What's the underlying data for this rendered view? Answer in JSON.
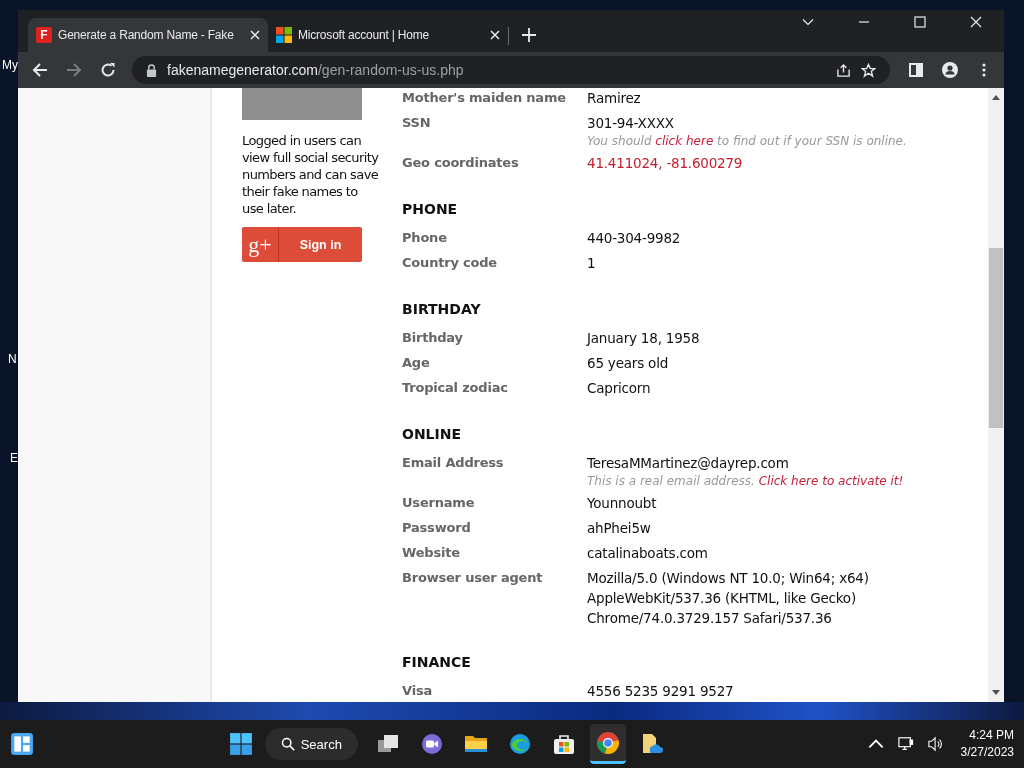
{
  "desktop_labels": [
    "My",
    "N",
    "E"
  ],
  "browser": {
    "tabs": [
      {
        "title": "Generate a Random Name - Fake",
        "selected": true,
        "kind": "letter",
        "favicon_text": "F"
      },
      {
        "title": "Microsoft account | Home",
        "selected": false,
        "kind": "squares"
      }
    ],
    "address": {
      "domain": "fakenamegenerator.com",
      "path": "/gen-random-us-us.php"
    },
    "back_disabled": false,
    "forward_disabled": true
  },
  "sidebar": {
    "note": "Logged in users can view full social security numbers and can save their fake names to use later.",
    "signin": {
      "logo": "g+",
      "label": "Sign in"
    }
  },
  "sections": [
    {
      "rows": [
        {
          "label": "Mother's maiden name",
          "value": [
            "Ramirez"
          ]
        },
        {
          "label": "SSN",
          "value": [
            "301-94-XXXX"
          ],
          "note": [
            {
              "text": "You should ",
              "link": false
            },
            {
              "text": "click here",
              "link": true
            },
            {
              "text": " to find out if your SSN is online.",
              "link": false
            }
          ]
        },
        {
          "label": "Geo coordinates",
          "value": [
            "41.411024, -81.600279"
          ],
          "link": true
        }
      ]
    },
    {
      "heading": "PHONE",
      "rows": [
        {
          "label": "Phone",
          "value": [
            "440-304-9982"
          ]
        },
        {
          "label": "Country code",
          "value": [
            "1"
          ]
        }
      ]
    },
    {
      "heading": "BIRTHDAY",
      "rows": [
        {
          "label": "Birthday",
          "value": [
            "January 18, 1958"
          ]
        },
        {
          "label": "Age",
          "value": [
            "65 years old"
          ]
        },
        {
          "label": "Tropical zodiac",
          "value": [
            "Capricorn"
          ]
        }
      ]
    },
    {
      "heading": "ONLINE",
      "rows": [
        {
          "label": "Email Address",
          "value": [
            "TeresaMMartinez@dayrep.com"
          ],
          "note": [
            {
              "text": "This is a real email address. ",
              "link": false
            },
            {
              "text": "Click here to activate it!",
              "link": true
            }
          ]
        },
        {
          "label": "Username",
          "value": [
            "Younnoubt"
          ]
        },
        {
          "label": "Password",
          "value": [
            "ahPhei5w"
          ]
        },
        {
          "label": "Website",
          "value": [
            "catalinaboats.com"
          ]
        },
        {
          "label": "Browser user agent",
          "value": [
            "Mozilla/5.0 (Windows NT 10.0; Win64; x64)",
            "AppleWebKit/537.36 (KHTML, like Gecko)",
            "Chrome/74.0.3729.157 Safari/537.36"
          ]
        }
      ]
    },
    {
      "heading": "FINANCE",
      "rows": [
        {
          "label": "Visa",
          "value": [
            "4556 5235 9291 9527"
          ]
        }
      ]
    }
  ],
  "taskbar": {
    "search": "Search",
    "time": "4:24 PM",
    "date": "3/27/2023",
    "apps": [
      {
        "kind": "files",
        "selected": false
      },
      {
        "kind": "chat",
        "selected": false
      },
      {
        "kind": "explorer",
        "selected": false
      },
      {
        "kind": "edge",
        "selected": false
      },
      {
        "kind": "store",
        "selected": false
      },
      {
        "kind": "chrome",
        "selected": true
      },
      {
        "kind": "cloud",
        "selected": false
      }
    ]
  }
}
